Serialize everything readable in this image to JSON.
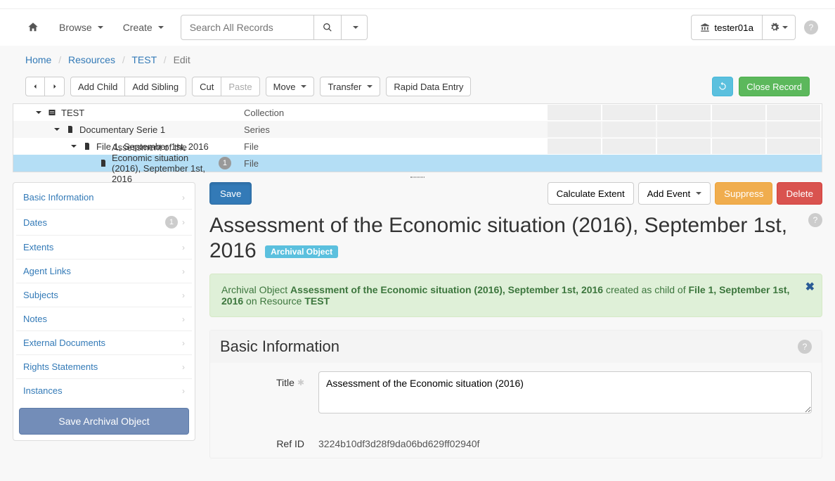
{
  "nav": {
    "browse": "Browse",
    "create": "Create",
    "search_placeholder": "Search All Records",
    "user": "tester01a"
  },
  "breadcrumb": {
    "home": "Home",
    "resources": "Resources",
    "test": "TEST",
    "edit": "Edit"
  },
  "toolbar": {
    "add_child": "Add Child",
    "add_sibling": "Add Sibling",
    "cut": "Cut",
    "paste": "Paste",
    "move": "Move",
    "transfer": "Transfer",
    "rapid": "Rapid Data Entry",
    "close": "Close Record"
  },
  "tree": {
    "rows": [
      {
        "label": "TEST",
        "type": "Collection"
      },
      {
        "label": "Documentary Serie 1",
        "type": "Series"
      },
      {
        "label": "File 1, September 1st, 2016",
        "type": "File"
      },
      {
        "label": "Assessment of the Economic situation (2016), September 1st, 2016",
        "type": "File",
        "badge": "1"
      }
    ]
  },
  "sidebar": {
    "items": [
      {
        "label": "Basic Information"
      },
      {
        "label": "Dates",
        "badge": "1"
      },
      {
        "label": "Extents"
      },
      {
        "label": "Agent Links"
      },
      {
        "label": "Subjects"
      },
      {
        "label": "Notes"
      },
      {
        "label": "External Documents"
      },
      {
        "label": "Rights Statements"
      },
      {
        "label": "Instances"
      }
    ],
    "save": "Save Archival Object"
  },
  "content": {
    "save": "Save",
    "calc_extent": "Calculate Extent",
    "add_event": "Add Event",
    "suppress": "Suppress",
    "delete": "Delete",
    "title": "Assessment of the Economic situation (2016), September 1st, 2016",
    "badge": "Archival Object",
    "alert_prefix": "Archival Object",
    "alert_obj": "Assessment of the Economic situation (2016), September 1st, 2016",
    "alert_mid": "created as child of",
    "alert_parent": "File 1, September 1st, 2016",
    "alert_on": "on Resource",
    "alert_res": "TEST",
    "section_basic": "Basic Information",
    "title_label": "Title",
    "title_value": "Assessment of the Economic situation (2016)",
    "refid_label": "Ref ID",
    "refid_value": "3224b10df3d28f9da06bd629ff02940f"
  }
}
